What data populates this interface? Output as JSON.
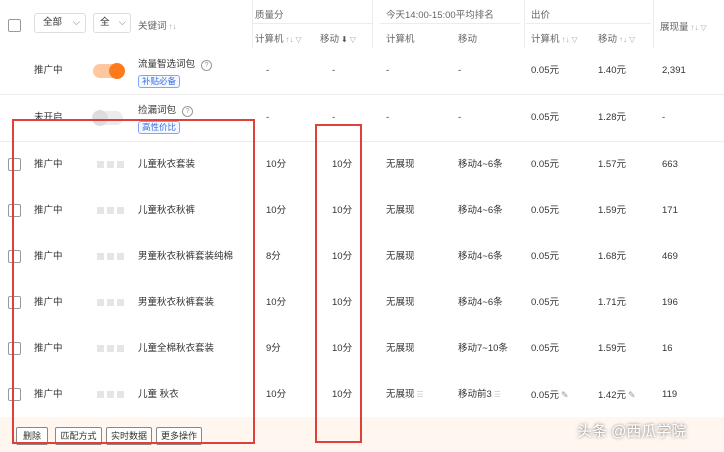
{
  "header": {
    "filter_all": "全部",
    "filter_all2": "全",
    "keyword": "关键词",
    "quality_group": "质量分",
    "rank_group": "今天14:00-15:00平均排名",
    "bid_group": "出价",
    "impressions": "展现量",
    "computer": "计算机",
    "mobile": "移动",
    "computer2": "计算机",
    "mobile2": "移动",
    "computer3": "计算机",
    "mobile3": "移动"
  },
  "rows": [
    {
      "status": "推广中",
      "toggle": "on",
      "keyword": "流量智选词包",
      "tag": "补贴必备",
      "q_pc": "-",
      "q_m": "-",
      "r_pc": "-",
      "r_m": "-",
      "b_pc": "0.05元",
      "b_m": "1.40元",
      "imp": "2,391"
    },
    {
      "status": "未开启",
      "toggle": "off",
      "keyword": "捡漏词包",
      "tag": "高性价比",
      "q_pc": "-",
      "q_m": "-",
      "r_pc": "-",
      "r_m": "-",
      "b_pc": "0.05元",
      "b_m": "1.28元",
      "imp": "-"
    },
    {
      "status": "推广中",
      "keyword": "儿童秋衣套装",
      "q_pc": "10分",
      "q_m": "10分",
      "r_pc": "无展现",
      "r_m": "移动4~6条",
      "b_pc": "0.05元",
      "b_m": "1.57元",
      "imp": "663"
    },
    {
      "status": "推广中",
      "keyword": "儿童秋衣秋裤",
      "q_pc": "10分",
      "q_m": "10分",
      "r_pc": "无展现",
      "r_m": "移动4~6条",
      "b_pc": "0.05元",
      "b_m": "1.59元",
      "imp": "171"
    },
    {
      "status": "推广中",
      "keyword": "男童秋衣秋裤套装纯棉",
      "q_pc": "8分",
      "q_m": "10分",
      "r_pc": "无展现",
      "r_m": "移动4~6条",
      "b_pc": "0.05元",
      "b_m": "1.68元",
      "imp": "469"
    },
    {
      "status": "推广中",
      "keyword": "男童秋衣秋裤套装",
      "q_pc": "10分",
      "q_m": "10分",
      "r_pc": "无展现",
      "r_m": "移动4~6条",
      "b_pc": "0.05元",
      "b_m": "1.71元",
      "imp": "196"
    },
    {
      "status": "推广中",
      "keyword": "儿童全棉秋衣套装",
      "q_pc": "9分",
      "q_m": "10分",
      "r_pc": "无展现",
      "r_m": "移动7~10条",
      "b_pc": "0.05元",
      "b_m": "1.59元",
      "imp": "16"
    },
    {
      "status": "推广中",
      "keyword": "儿童 秋衣",
      "q_pc": "10分",
      "q_m": "10分",
      "r_pc": "无展现",
      "r_m": "移动前3",
      "b_pc": "0.05元",
      "b_m": "1.42元",
      "imp": "119"
    }
  ],
  "bottom": {
    "delete": "删除",
    "match": "匹配方式",
    "realtime": "实时数据",
    "more": "更多操作"
  },
  "watermark": "头条 @西瓜学院",
  "colors": {
    "accent": "#ff7a1a",
    "status_green": "#2f9e44",
    "highlight": "#e0403a"
  }
}
